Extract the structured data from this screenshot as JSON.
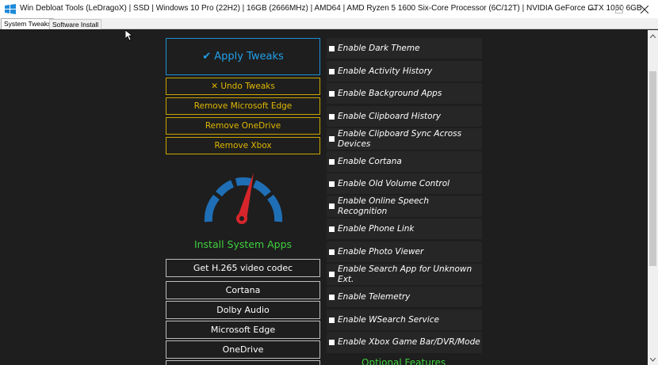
{
  "window": {
    "title": "Win Debloat Tools (LeDragoX) | SSD | Windows 10 Pro (22H2) | 16GB (2666MHz) | AMD64 | AMD Ryzen 5 1600 Six-Core Processor (6C/12T) | NVIDIA GeForce GTX 1060 6GB",
    "icon": "windows-logo-icon",
    "controls": [
      "minimize-icon",
      "maximize-icon",
      "close-icon"
    ]
  },
  "tabs": [
    {
      "label": "System Tweaks",
      "selected": true
    },
    {
      "label": "Software Install",
      "selected": false
    }
  ],
  "left_panel": {
    "apply_label": "✔ Apply Tweaks",
    "undo_label": "✕ Undo Tweaks",
    "remove_edge_label": "Remove Microsoft Edge",
    "remove_onedrive_label": "Remove OneDrive",
    "remove_xbox_label": "Remove Xbox",
    "gauge_icon": "speedometer-icon",
    "install_heading": "Install System Apps",
    "apps": [
      "Get H.265 video codec",
      "Cortana",
      "Dolby Audio",
      "Microsoft Edge",
      "OneDrive"
    ]
  },
  "tweaks": [
    "Enable Dark Theme",
    "Enable Activity History",
    "Enable Background Apps",
    "Enable Clipboard History",
    "Enable Clipboard Sync Across Devices",
    "Enable Cortana",
    "Enable Old Volume Control",
    "Enable Online Speech Recognition",
    "Enable Phone Link",
    "Enable Photo Viewer",
    "Enable Search App for Unknown Ext.",
    "Enable Telemetry",
    "Enable WSearch Service",
    "Enable Xbox Game Bar/DVR/Mode"
  ],
  "optional_heading": "Optional Features",
  "colors": {
    "background": "#1e1e1e",
    "accent_blue": "#22a0ea",
    "accent_yellow": "#e0b800",
    "accent_green": "#3fd13f"
  }
}
